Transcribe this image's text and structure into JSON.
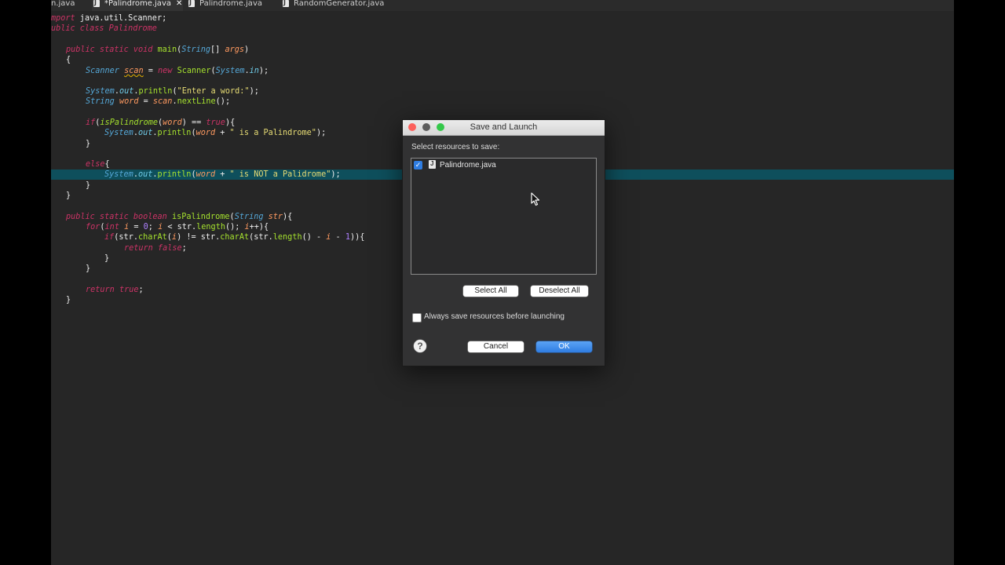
{
  "tabs": [
    {
      "label": "n.java",
      "active": false,
      "has_icon": false
    },
    {
      "label": "*Palindrome.java",
      "active": true,
      "has_icon": true,
      "close": "✕"
    },
    {
      "label": "Palindrome.java",
      "active": false,
      "has_icon": true
    },
    {
      "label": "RandomGenerator.java",
      "active": false,
      "has_icon": true
    }
  ],
  "code": {
    "line1": {
      "a": "mport",
      "b": " java.util.Scanner;"
    },
    "line2": {
      "a": "ublic class Palindrome"
    },
    "line3": {
      "a": "public static void",
      "b": " main",
      "c": "(",
      "d": "String",
      "e": "[] ",
      "f": "args",
      "g": ")"
    },
    "line4": {
      "a": "{"
    },
    "line5": {
      "a": "Scanner",
      "b": " ",
      "c": "scan",
      "d": " = ",
      "e": "new",
      "f": " Scanner",
      "g": "(",
      "h": "System",
      "i": ".",
      "j": "in",
      "k": ");"
    },
    "line6": {
      "a": "System",
      "b": ".",
      "c": "out",
      "d": ".",
      "e": "println",
      "f": "(",
      "g": "\"Enter a word:\"",
      "h": ");"
    },
    "line7": {
      "a": "String",
      "b": " ",
      "c": "word",
      "d": " = ",
      "e": "scan",
      "f": ".",
      "g": "nextLine",
      "h": "();"
    },
    "line8": {
      "a": "if",
      "b": "(",
      "c": "isPalindrome",
      "d": "(",
      "e": "word",
      "f": ") == ",
      "g": "true",
      "h": "){"
    },
    "line9": {
      "a": "System",
      "b": ".",
      "c": "out",
      "d": ".",
      "e": "println",
      "f": "(",
      "g": "word",
      "h": " + ",
      "i": "\" is a Palindrome\"",
      "j": ");"
    },
    "line10": {
      "a": "}"
    },
    "line11": {
      "a": "else",
      "b": "{"
    },
    "line12": {
      "a": "System",
      "b": ".",
      "c": "out",
      "d": ".",
      "e": "println",
      "f": "(",
      "g": "word",
      "h": " + ",
      "i": "\" is NOT a Palidrome\"",
      "j": ");"
    },
    "line13": {
      "a": "}"
    },
    "line14": {
      "a": "}"
    },
    "line15": {
      "a": "public static boolean",
      "b": " isPalindrome",
      "c": "(",
      "d": "String",
      "e": " ",
      "f": "str",
      "g": "){"
    },
    "line16": {
      "a": "for",
      "b": "(",
      "c": "int",
      "d": " ",
      "e": "i",
      "f": " = ",
      "g": "0",
      "h": "; ",
      "i": "i",
      "j": " < ",
      "k": "str",
      "l": ".",
      "m": "length",
      "n": "(); ",
      "o": "i",
      "p": "++){"
    },
    "line17": {
      "a": "if",
      "b": "(",
      "c": "str",
      "d": ".",
      "e": "charAt",
      "f": "(",
      "g": "i",
      "h": ") != ",
      "i": "str",
      "j": ".",
      "k": "charAt",
      "l": "(",
      "m": "str",
      "n": ".",
      "o": "length",
      "p": "() - ",
      "q": "i",
      "r": " - ",
      "s": "1",
      "t": ")){"
    },
    "line18": {
      "a": "return",
      "b": " ",
      "c": "false",
      "d": ";"
    },
    "line19": {
      "a": "}"
    },
    "line20": {
      "a": "}"
    },
    "line21": {
      "a": "return",
      "b": " ",
      "c": "true",
      "d": ";"
    },
    "line22": {
      "a": "}"
    }
  },
  "dialog": {
    "title": "Save and Launch",
    "resources_label": "Select resources to save:",
    "resource": {
      "name": "Palindrome.java",
      "checked": true,
      "check_glyph": "✓"
    },
    "select_all": "Select All",
    "deselect_all": "Deselect All",
    "always_save_label": "Always save resources before launching",
    "always_save_checked": false,
    "help_glyph": "?",
    "cancel": "Cancel",
    "ok": "OK"
  },
  "colors": {
    "highlight_line": "#0e4f5c",
    "ok_button": "#2f7de2",
    "traffic_close": "#fc605c",
    "traffic_minimize": "#5d5d5d",
    "traffic_zoom": "#34c84a"
  },
  "icons": {
    "java_file": "java-file-icon",
    "help": "help-icon",
    "cursor": "mouse-pointer-icon"
  }
}
